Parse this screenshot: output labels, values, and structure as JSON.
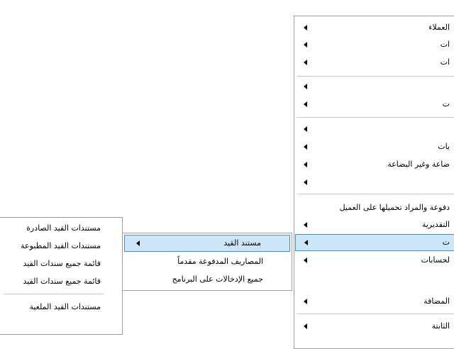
{
  "main_menu": {
    "items": [
      {
        "label": "العملاء"
      },
      {
        "label": "ات"
      },
      {
        "label": "ات"
      },
      {
        "label": ""
      },
      {
        "label": "ت"
      },
      {
        "label": ""
      },
      {
        "label": "يات"
      },
      {
        "label": "ضاعة وغير البضاعة"
      },
      {
        "label": ""
      },
      {
        "label": "دفوعة والمراد تحميلها على العميل"
      },
      {
        "label": "التقديرية"
      },
      {
        "label": "ت"
      },
      {
        "label": "لحسابات"
      },
      {
        "label": ""
      },
      {
        "label": "المضافة"
      },
      {
        "label": "الثابتة"
      }
    ]
  },
  "sub_menu": {
    "items": [
      {
        "label": "مستند القيد"
      },
      {
        "label": "المصاريف المدفوعة مقدماً"
      },
      {
        "label": "جميع الإدخالات على البرنامج"
      }
    ]
  },
  "third_menu": {
    "items": [
      {
        "label": "مستندات القيد الصادرة"
      },
      {
        "label": "مستندات القيد المطبوعة"
      },
      {
        "label": "قائمة جميع سندات القيد"
      },
      {
        "label": "قائمة جميع سندات القيد"
      },
      {
        "label": "مستندات القيد الملغية"
      }
    ]
  }
}
